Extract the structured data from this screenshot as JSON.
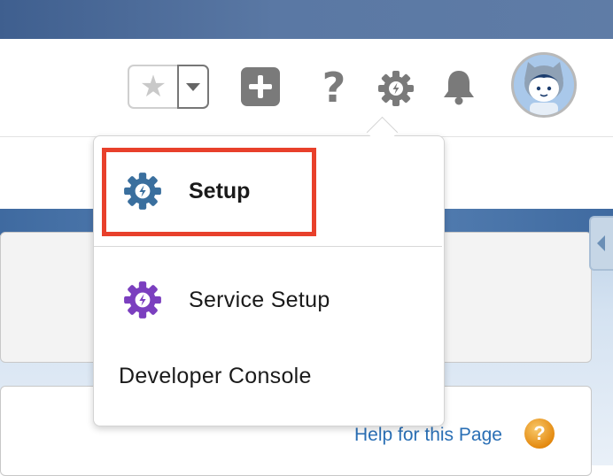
{
  "header": {
    "favorites": {
      "star_icon": "star-icon",
      "caret_icon": "chevron-down-icon"
    },
    "icons": [
      "plus-icon",
      "help-icon",
      "gear-icon",
      "bell-icon",
      "avatar"
    ],
    "help_glyph": "?"
  },
  "setup_menu": {
    "items": [
      {
        "label": "Setup",
        "icon": "setup-gear-icon",
        "color": "#3a6f9e"
      },
      {
        "label": "Service Setup",
        "icon": "service-gear-icon",
        "color": "#7b3fbf"
      },
      {
        "label": "Developer Console"
      }
    ],
    "highlight_color": "#e8402b"
  },
  "page": {
    "help_link": "Help for this Page",
    "help_orb_glyph": "?"
  }
}
